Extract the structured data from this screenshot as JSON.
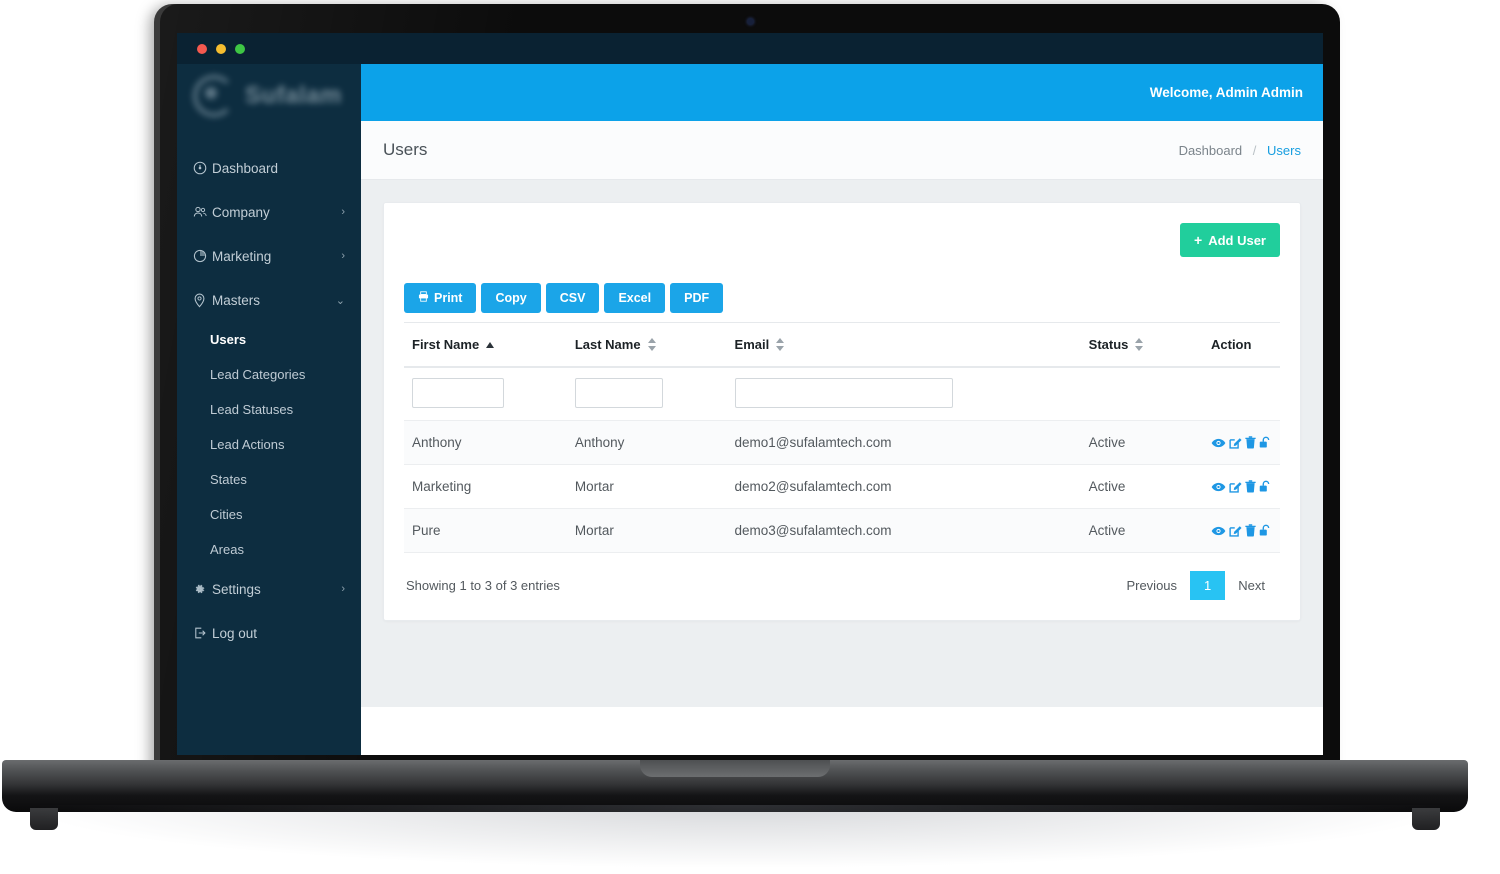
{
  "window": {
    "traffic_lights": [
      "close-red",
      "minimize-yellow",
      "maximize-green"
    ]
  },
  "brand": {
    "name": "Sufalam",
    "logo_icon": "circular-logo-mark"
  },
  "sidebar": {
    "items": [
      {
        "label": "Dashboard",
        "icon": "dashboard-icon",
        "chevron": "",
        "active": false
      },
      {
        "label": "Company",
        "icon": "company-users-icon",
        "chevron": "›",
        "active": false
      },
      {
        "label": "Marketing",
        "icon": "marketing-pie-icon",
        "chevron": "›",
        "active": false
      },
      {
        "label": "Masters",
        "icon": "masters-pin-icon",
        "chevron": "⌄",
        "active": false
      }
    ],
    "masters_children": [
      {
        "label": "Users",
        "active": true
      },
      {
        "label": "Lead Categories",
        "active": false
      },
      {
        "label": "Lead Statuses",
        "active": false
      },
      {
        "label": "Lead Actions",
        "active": false
      },
      {
        "label": "States",
        "active": false
      },
      {
        "label": "Cities",
        "active": false
      },
      {
        "label": "Areas",
        "active": false
      }
    ],
    "footer_items": [
      {
        "label": "Settings",
        "icon": "gear-icon",
        "chevron": "›"
      },
      {
        "label": "Log out",
        "icon": "logout-icon",
        "chevron": ""
      }
    ]
  },
  "topbar": {
    "welcome": "Welcome, Admin Admin",
    "background": "#0ca2e9"
  },
  "pagehead": {
    "title": "Users",
    "breadcrumb_root": "Dashboard",
    "breadcrumb_sep": "/",
    "breadcrumb_current": "Users"
  },
  "toolbar": {
    "add_user_label": "Add User",
    "add_user_plus": "+",
    "add_user_color": "#21ce9c",
    "export_buttons": [
      {
        "label": "Print",
        "icon": "printer-icon"
      },
      {
        "label": "Copy",
        "icon": ""
      },
      {
        "label": "CSV",
        "icon": ""
      },
      {
        "label": "Excel",
        "icon": ""
      },
      {
        "label": "PDF",
        "icon": ""
      }
    ],
    "export_color": "#1ba5e8"
  },
  "table": {
    "columns": [
      {
        "label": "First Name",
        "sort": "asc"
      },
      {
        "label": "Last Name",
        "sort": "both"
      },
      {
        "label": "Email",
        "sort": "both"
      },
      {
        "label": "Status",
        "sort": "both"
      },
      {
        "label": "Action",
        "sort": "none"
      }
    ],
    "filters": {
      "first_name": "",
      "last_name": "",
      "email": ""
    },
    "rows": [
      {
        "first_name": "Anthony",
        "last_name": "Anthony",
        "email": "demo1@sufalamtech.com",
        "status": "Active"
      },
      {
        "first_name": "Marketing",
        "last_name": "Mortar",
        "email": "demo2@sufalamtech.com",
        "status": "Active"
      },
      {
        "first_name": "Pure",
        "last_name": "Mortar",
        "email": "demo3@sufalamtech.com",
        "status": "Active"
      }
    ],
    "row_actions": [
      "view-eye-icon",
      "edit-pencil-icon",
      "delete-trash-icon",
      "unlock-padlock-icon"
    ],
    "action_color": "#1e97e4"
  },
  "footer": {
    "entries_text": "Showing 1 to 3 of 3 entries",
    "previous": "Previous",
    "page": "1",
    "next": "Next",
    "active_page_color": "#28c3f3"
  }
}
